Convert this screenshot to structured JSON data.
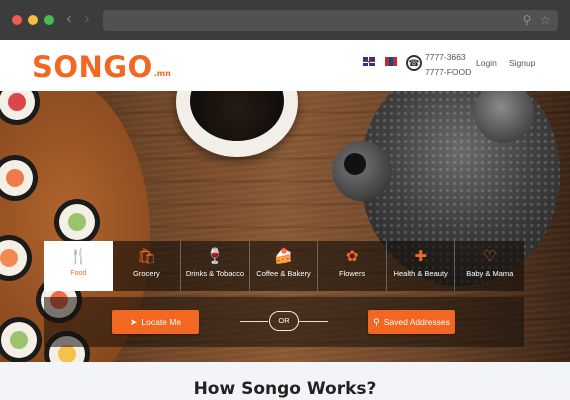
{
  "browser": {
    "nav": {
      "back_icon": "chevron-left-icon",
      "forward_icon": "chevron-right-icon"
    },
    "url_bar": {
      "search_icon": "search-icon",
      "star_icon": "star-icon"
    },
    "traffic_lights": [
      "#f05a4f",
      "#f5be3f",
      "#45c04f"
    ]
  },
  "header": {
    "logo": {
      "text": "SONGO",
      "suffix": ".mn",
      "color": "#f26722"
    },
    "languages": [
      {
        "name": "uk-flag-icon"
      },
      {
        "name": "mongolia-flag-icon",
        "colors": [
          "#c4272f",
          "#015197",
          "#c4272f"
        ]
      }
    ],
    "phone": {
      "icon": "phone-icon",
      "line1": "7777-3663",
      "line2": "7777-FOOD"
    },
    "login_label": "Login",
    "signup_label": "Signup"
  },
  "hero": {
    "categories": [
      {
        "label": "Food",
        "icon": "food-icon",
        "glyph": "🍴",
        "active": true
      },
      {
        "label": "Grocery",
        "icon": "grocery-bag-icon",
        "glyph": "🛍",
        "active": false
      },
      {
        "label": "Drinks & Tobacco",
        "icon": "drinks-icon",
        "glyph": "🍷",
        "active": false
      },
      {
        "label": "Coffee & Bakery",
        "icon": "cake-icon",
        "glyph": "🍰",
        "active": false
      },
      {
        "label": "Flowers",
        "icon": "flowers-icon",
        "glyph": "✿",
        "active": false
      },
      {
        "label": "Health & Beauty",
        "icon": "first-aid-icon",
        "glyph": "✚",
        "active": false
      },
      {
        "label": "Baby & Mama",
        "icon": "stroller-icon",
        "glyph": "♡",
        "active": false
      }
    ],
    "locate_button": {
      "label": "Locate Me",
      "icon": "location-arrow-icon",
      "glyph": "➤"
    },
    "or_label": "OR",
    "saved_button": {
      "label": "Saved Addresses",
      "icon": "map-pin-icon",
      "glyph": "⚲"
    },
    "accent": "#f26722"
  },
  "how": {
    "title": "How Songo Works?"
  }
}
